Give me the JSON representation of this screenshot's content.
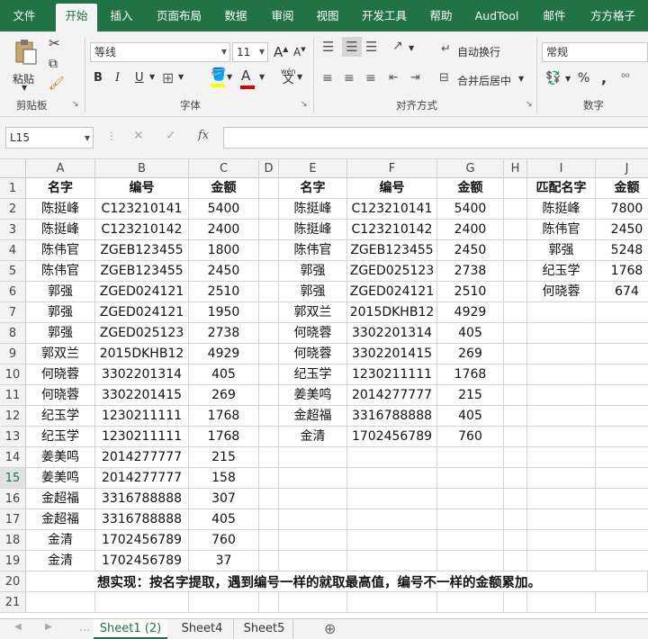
{
  "tabs": [
    "文件",
    "开始",
    "插入",
    "页面布局",
    "数据",
    "审阅",
    "视图",
    "开发工具",
    "帮助",
    "AudTool",
    "邮件",
    "方方格子"
  ],
  "active_tab": "开始",
  "ribbon": {
    "paste_label": "粘贴",
    "clipboard_label": "剪贴板",
    "font_name": "等线",
    "font_size": "11",
    "font_group_label": "字体",
    "bold": "B",
    "italic": "I",
    "underline": "U",
    "wrap_text": "自动换行",
    "merge_center": "合并后居中",
    "align_group_label": "对齐方式",
    "number_format": "常规",
    "percent": "%",
    "comma": ",",
    "number_group_label": "数字",
    "grow_font": "A",
    "shrink_font": "A",
    "font_color_letter": "A",
    "phonetic": "wén"
  },
  "formula_bar": {
    "name_box": "L15",
    "fx": "fx",
    "content": ""
  },
  "columns": [
    "A",
    "B",
    "C",
    "D",
    "E",
    "F",
    "G",
    "H",
    "I",
    "J"
  ],
  "rows": [
    "1",
    "2",
    "3",
    "4",
    "5",
    "6",
    "7",
    "8",
    "9",
    "10",
    "11",
    "12",
    "13",
    "14",
    "15",
    "16",
    "17",
    "18",
    "19",
    "20",
    "21"
  ],
  "table1": {
    "headers": [
      "名字",
      "编号",
      "金额"
    ],
    "rows": [
      [
        "陈挺峰",
        "C123210141",
        "5400"
      ],
      [
        "陈挺峰",
        "C123210142",
        "2400"
      ],
      [
        "陈伟官",
        "ZGEB123455",
        "1800"
      ],
      [
        "陈伟官",
        "ZGEB123455",
        "2450"
      ],
      [
        "郭强",
        "ZGED024121",
        "2510"
      ],
      [
        "郭强",
        "ZGED024121",
        "1950"
      ],
      [
        "郭强",
        "ZGED025123",
        "2738"
      ],
      [
        "郭双兰",
        "2015DKHB12",
        "4929"
      ],
      [
        "何晓蓉",
        "3302201314",
        "405"
      ],
      [
        "何晓蓉",
        "3302201415",
        "269"
      ],
      [
        "纪玉学",
        "1230211111",
        "1768"
      ],
      [
        "纪玉学",
        "1230211111",
        "1768"
      ],
      [
        "姜美鸣",
        "2014277777",
        "215"
      ],
      [
        "姜美鸣",
        "2014277777",
        "158"
      ],
      [
        "金超福",
        "3316788888",
        "307"
      ],
      [
        "金超福",
        "3316788888",
        "405"
      ],
      [
        "金清",
        "1702456789",
        "760"
      ],
      [
        "金清",
        "1702456789",
        "37"
      ]
    ]
  },
  "table2": {
    "headers": [
      "名字",
      "编号",
      "金额"
    ],
    "rows": [
      [
        "陈挺峰",
        "C123210141",
        "5400"
      ],
      [
        "陈挺峰",
        "C123210142",
        "2400"
      ],
      [
        "陈伟官",
        "ZGEB123455",
        "2450"
      ],
      [
        "郭强",
        "ZGED025123",
        "2738"
      ],
      [
        "郭强",
        "ZGED024121",
        "2510"
      ],
      [
        "郭双兰",
        "2015DKHB12",
        "4929"
      ],
      [
        "何晓蓉",
        "3302201314",
        "405"
      ],
      [
        "何晓蓉",
        "3302201415",
        "269"
      ],
      [
        "纪玉学",
        "1230211111",
        "1768"
      ],
      [
        "姜美鸣",
        "2014277777",
        "215"
      ],
      [
        "金超福",
        "3316788888",
        "405"
      ],
      [
        "金清",
        "1702456789",
        "760"
      ]
    ]
  },
  "table3": {
    "headers": [
      "匹配名字",
      "金额"
    ],
    "rows": [
      [
        "陈挺峰",
        "7800"
      ],
      [
        "陈伟官",
        "2450"
      ],
      [
        "郭强",
        "5248"
      ],
      [
        "纪玉学",
        "1768"
      ],
      [
        "何晓蓉",
        "674"
      ]
    ]
  },
  "note": "想实现：按名字提取，遇到编号一样的就取最高值，编号不一样的金额累加。",
  "sheets": [
    "Sheet1 (2)",
    "Sheet4",
    "Sheet5"
  ],
  "active_sheet": "Sheet1 (2)",
  "colors": {
    "excel_green": "#217346",
    "ribbon_bg": "#f3f3f3",
    "grid_line": "#d4d4d4"
  }
}
